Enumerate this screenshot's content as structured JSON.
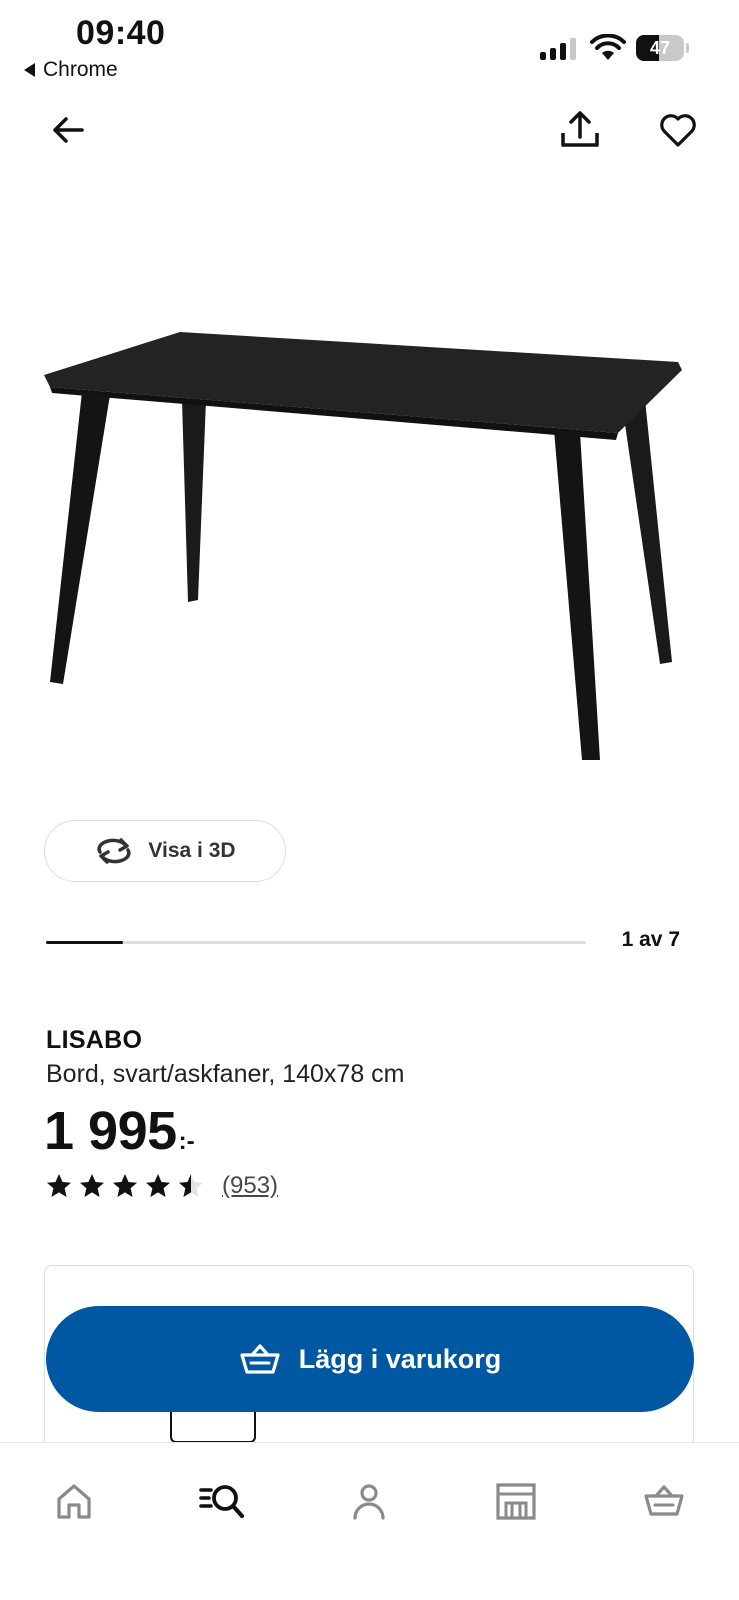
{
  "status_bar": {
    "time": "09:40",
    "back_app": "Chrome",
    "battery": "47"
  },
  "nav": {
    "back_icon": "arrow-left-icon",
    "share_icon": "share-icon",
    "favorite_icon": "heart-icon"
  },
  "product_image": {
    "icon": "table-image"
  },
  "view3d": {
    "label": "Visa i 3D",
    "icon": "rotate-icon"
  },
  "gallery": {
    "counter": "1 av 7",
    "current": 1,
    "total": 7
  },
  "product": {
    "name": "LISABO",
    "description": "Bord, svart/askfaner, 140x78 cm",
    "price": "1 995",
    "price_suffix": ":-",
    "rating_value": 4.5,
    "rating_max": 5,
    "review_count": "(953)"
  },
  "cta": {
    "label": "Lägg i varukorg",
    "icon": "basket-icon",
    "color": "#0058a3"
  },
  "bottom_nav": {
    "items": [
      {
        "icon": "home-icon"
      },
      {
        "icon": "search-list-icon"
      },
      {
        "icon": "profile-icon"
      },
      {
        "icon": "store-icon"
      },
      {
        "icon": "basket-icon"
      }
    ]
  }
}
